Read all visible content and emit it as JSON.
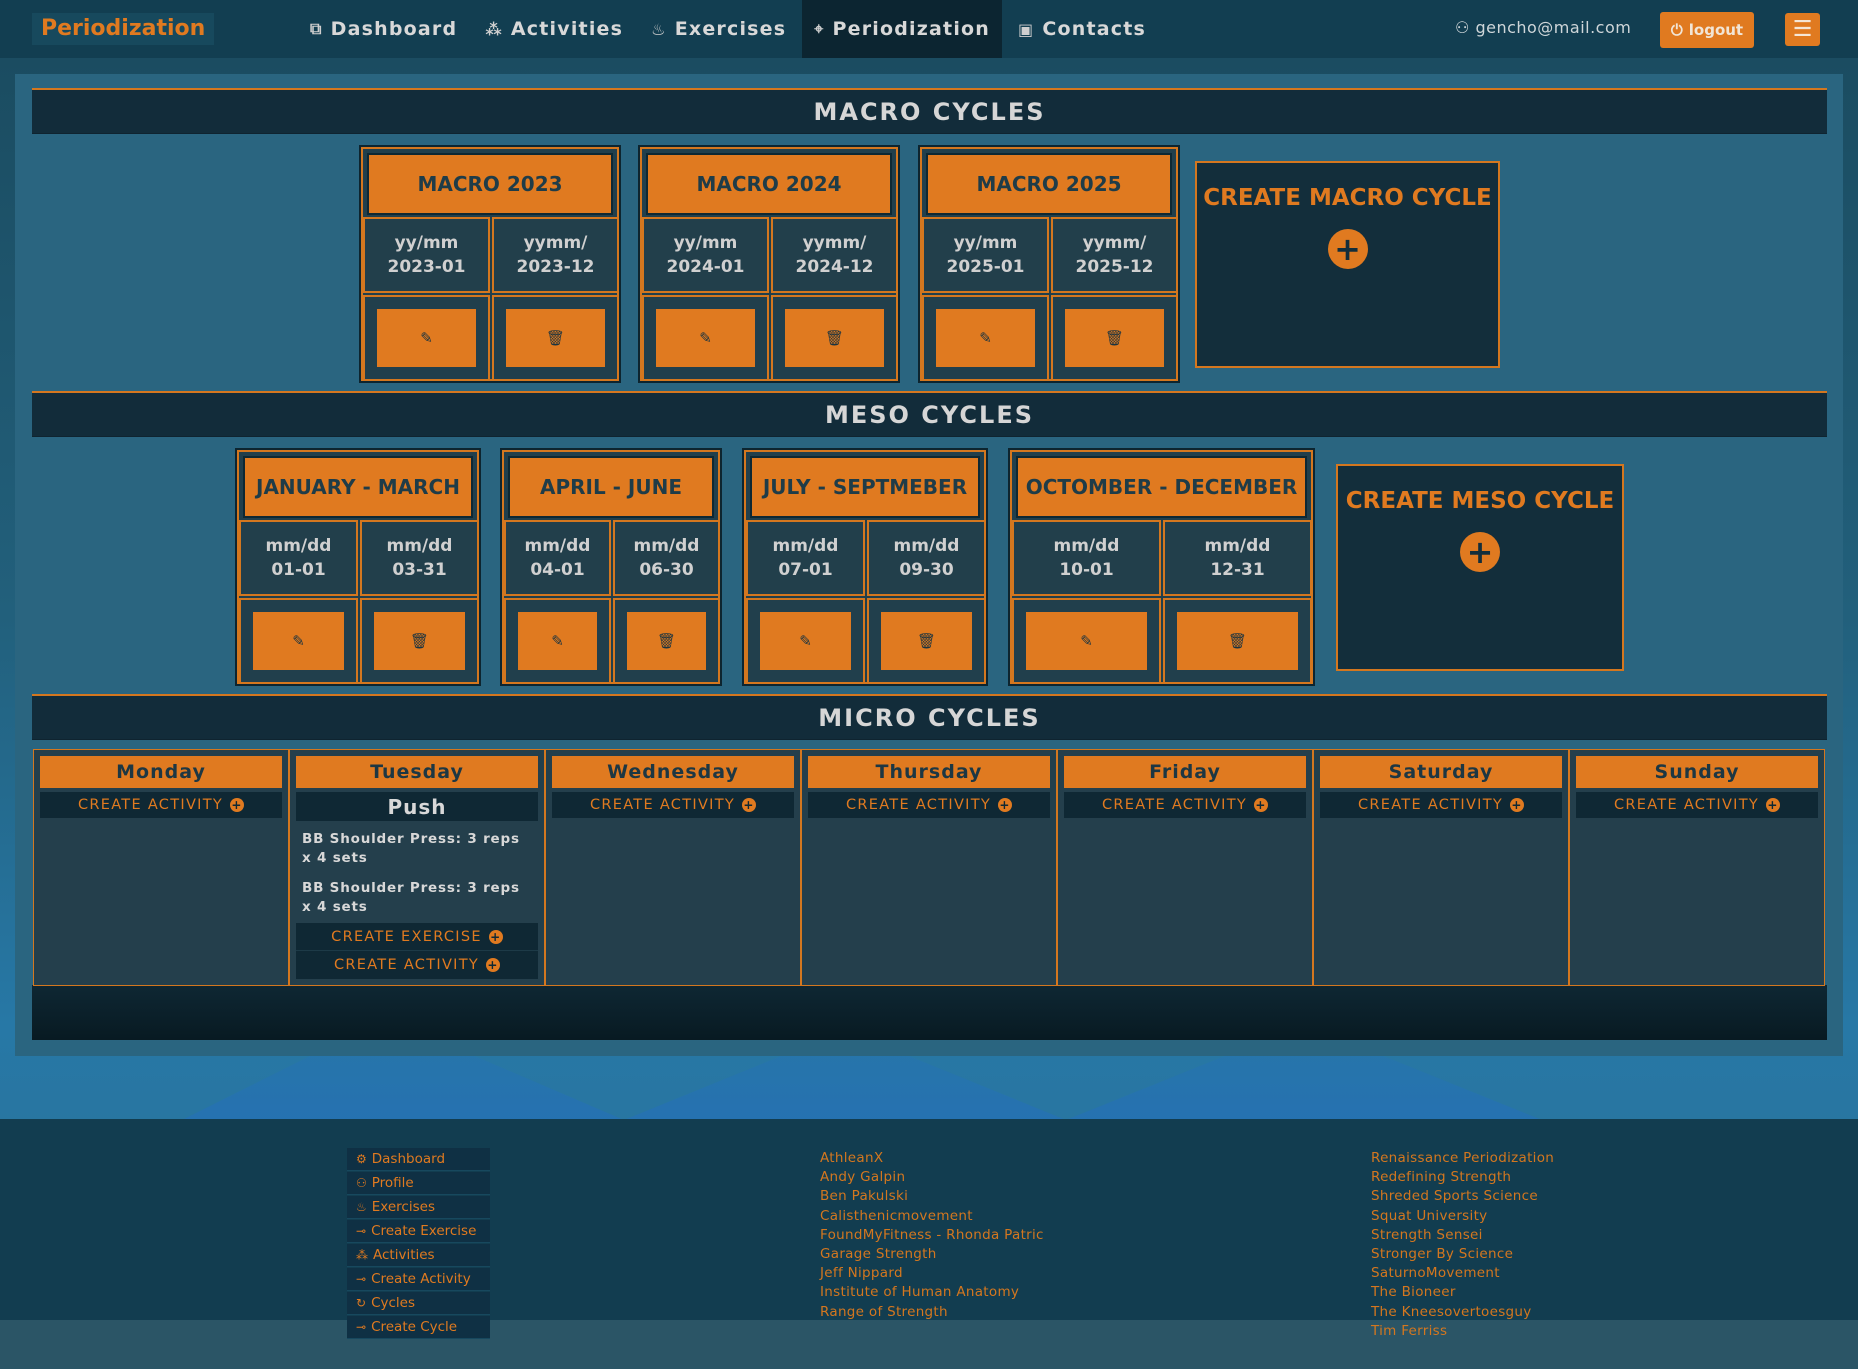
{
  "nav": {
    "brand": "Periodization",
    "links": [
      {
        "label": "Dashboard",
        "icon": "dashboard-icon",
        "glyph": "⧉"
      },
      {
        "label": "Activities",
        "icon": "activities-icon",
        "glyph": "⁂"
      },
      {
        "label": "Exercises",
        "icon": "flame-icon",
        "glyph": "♨"
      },
      {
        "label": "Periodization",
        "icon": "crosshair-icon",
        "glyph": "⌖",
        "active": true
      },
      {
        "label": "Contacts",
        "icon": "contact-card-icon",
        "glyph": "▣"
      }
    ],
    "user": "gencho@mail.com",
    "logout": "logout"
  },
  "macro": {
    "heading": "MACRO CYCLES",
    "create": "CREATE MACRO CYCLE",
    "cards": [
      {
        "title": "MACRO 2023",
        "start_label": "yy/mm",
        "start": "2023-01",
        "end_label": "yymm/",
        "end": "2023-12"
      },
      {
        "title": "MACRO 2024",
        "start_label": "yy/mm",
        "start": "2024-01",
        "end_label": "yymm/",
        "end": "2024-12"
      },
      {
        "title": "MACRO 2025",
        "start_label": "yy/mm",
        "start": "2025-01",
        "end_label": "yymm/",
        "end": "2025-12"
      }
    ]
  },
  "meso": {
    "heading": "MESO CYCLES",
    "create": "CREATE MESO CYCLE",
    "cards": [
      {
        "title": "JANUARY - MARCH",
        "start_label": "mm/dd",
        "start": "01-01",
        "end_label": "mm/dd",
        "end": "03-31"
      },
      {
        "title": "APRIL - JUNE",
        "start_label": "mm/dd",
        "start": "04-01",
        "end_label": "mm/dd",
        "end": "06-30"
      },
      {
        "title": "JULY - SEPTMEBER",
        "start_label": "mm/dd",
        "start": "07-01",
        "end_label": "mm/dd",
        "end": "09-30"
      },
      {
        "title": "OCTOMBER - DECEMBER",
        "start_label": "mm/dd",
        "start": "10-01",
        "end_label": "mm/dd",
        "end": "12-31"
      }
    ]
  },
  "micro": {
    "heading": "MICRO CYCLES",
    "create_activity": "CREATE ACTIVITY",
    "create_exercise": "CREATE EXERCISE",
    "days": [
      "Monday",
      "Tuesday",
      "Wednesday",
      "Thursday",
      "Friday",
      "Saturday",
      "Sunday"
    ],
    "tuesday_activity": {
      "title": "Push",
      "exercises": [
        "BB Shoulder Press: 3 reps x 4 sets",
        "BB Shoulder Press: 3 reps x 4 sets"
      ]
    }
  },
  "footer": {
    "nav": [
      {
        "label": "Dashboard",
        "icon": "gear-icon",
        "glyph": "⚙"
      },
      {
        "label": "Profile",
        "icon": "user-icon",
        "glyph": "⚇"
      },
      {
        "label": "Exercises",
        "icon": "flame-icon",
        "glyph": "♨"
      },
      {
        "label": "Create Exercise",
        "icon": "create-icon",
        "glyph": "⊸"
      },
      {
        "label": "Activities",
        "icon": "activities-icon",
        "glyph": "⁂"
      },
      {
        "label": "Create Activity",
        "icon": "create-icon",
        "glyph": "⊸"
      },
      {
        "label": "Cycles",
        "icon": "cycle-icon",
        "glyph": "↻"
      },
      {
        "label": "Create Cycle",
        "icon": "create-icon",
        "glyph": "⊸"
      }
    ],
    "col1": [
      "AthleanX",
      "Andy Galpin",
      "Ben Pakulski",
      "Calisthenicmovement",
      "FoundMyFitness - Rhonda Patric",
      "Garage Strength",
      "Jeff Nippard",
      "Institute of Human Anatomy",
      "Range of Strength"
    ],
    "col2": [
      "Renaissance Periodization",
      "Redefining Strength",
      "Shreded Sports Science",
      "Squat University",
      "Strength Sensei",
      "Stronger By Science",
      "SaturnoMovement",
      "The Bioneer",
      "The Kneesovertoesguy",
      "Tim Ferriss"
    ]
  },
  "colors": {
    "accent": "#e07a20",
    "panel": "#2a6580",
    "dark": "#122c3a"
  }
}
